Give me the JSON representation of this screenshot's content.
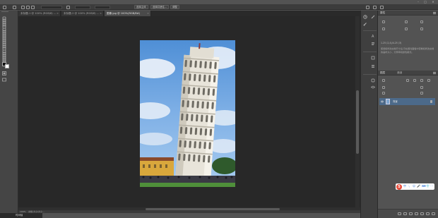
{
  "window": {
    "min_glyph": "–",
    "max_glyph": "□",
    "close_glyph": "✕"
  },
  "options_bar": {
    "buttons": [
      "选择主体",
      "选择并遮住..."
    ],
    "adjust_label": "调整"
  },
  "tabs": [
    {
      "label": "未标题-1 @ 100% (RGB/8) ...",
      "close": "×",
      "active": false
    },
    {
      "label": "未标题-2 @ 100% (RGB/8) ...",
      "close": "×",
      "active": false
    },
    {
      "label": "图像.jpg @ 100%(RGB/8#)",
      "close": "×",
      "active": true
    }
  ],
  "tools": [
    "move-icon",
    "marquee-icon",
    "lasso-icon",
    "quick-select-icon",
    "crop-icon",
    "eyedropper-icon",
    "healing-brush-icon",
    "brush-icon",
    "stamp-icon",
    "history-brush-icon",
    "eraser-icon",
    "gradient-icon",
    "blur-icon",
    "dodge-icon",
    "pen-icon",
    "type-icon",
    "path-select-icon",
    "shape-icon",
    "hand-icon",
    "zoom-icon",
    "more-icon"
  ],
  "status": {
    "zoom": "100%",
    "doc": "文档:大小/大小..."
  },
  "bottom_label": "时间轴",
  "panels": {
    "properties": {
      "title": "属性",
      "dims": "1.25 (2,4)/4.25 (3)",
      "para": "使用和修改文档尺寸后,可在属性面板中查看和修改文档的画布大小、分辨率和颜色模式。"
    },
    "layers": {
      "title": "图层",
      "title2": "通道",
      "layer_name": "背景"
    }
  },
  "ime": {
    "logo": "S",
    "items": [
      "中",
      "·,",
      "☺",
      "🎤",
      "⌨",
      "👕",
      "⋯"
    ]
  }
}
